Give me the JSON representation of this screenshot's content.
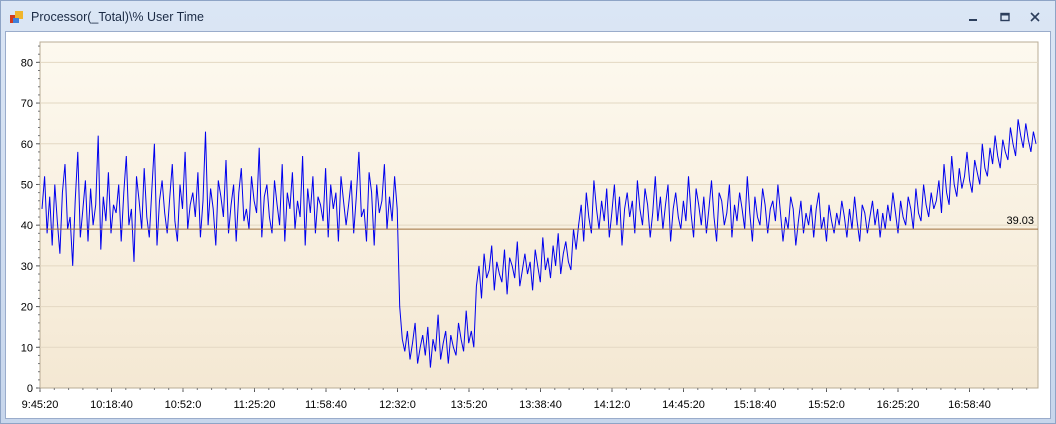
{
  "window": {
    "title": "Processor(_Total)\\% User Time",
    "colors": {
      "frame": "#c7d6ec",
      "plot_top": "#fdf9ef",
      "plot_bottom": "#f4e8d3",
      "series": "#0000ee",
      "avg_line": "#a0703c"
    }
  },
  "icons": [
    "app-icon",
    "minimize-icon",
    "restore-icon",
    "close-icon"
  ],
  "chart_data": {
    "type": "line",
    "title": "",
    "xlabel": "",
    "ylabel": "",
    "ylim": [
      0,
      85
    ],
    "yticks": [
      0,
      10,
      20,
      30,
      40,
      50,
      60,
      70,
      80
    ],
    "xticks": [
      "9:45:20",
      "10:18:40",
      "10:52:0",
      "11:25:20",
      "11:58:40",
      "12:32:0",
      "13:5:20",
      "13:38:40",
      "14:12:0",
      "14:45:20",
      "15:18:40",
      "15:52:0",
      "16:25:20",
      "16:58:40"
    ],
    "x_start": "9:45:20",
    "x_tick_interval": "0:33:20",
    "grid": true,
    "average": {
      "value": 39.03,
      "label": "39.03"
    },
    "series": [
      {
        "values": [
          44,
          52,
          38,
          47,
          35,
          50,
          41,
          33,
          48,
          55,
          39,
          42,
          30,
          46,
          58,
          37,
          44,
          51,
          36,
          49,
          40,
          45,
          62,
          34,
          47,
          41,
          53,
          38,
          45,
          43,
          50,
          36,
          48,
          57,
          40,
          44,
          31,
          52,
          46,
          39,
          54,
          42,
          37,
          49,
          60,
          35,
          46,
          51,
          43,
          38,
          47,
          55,
          41,
          36,
          50,
          44,
          58,
          39,
          45,
          48,
          42,
          53,
          37,
          46,
          63,
          40,
          49,
          44,
          35,
          51,
          47,
          42,
          56,
          38,
          45,
          50,
          36,
          48,
          54,
          41,
          44,
          39,
          52,
          46,
          43,
          59,
          37,
          47,
          50,
          42,
          38,
          51,
          45,
          40,
          55,
          36,
          48,
          44,
          53,
          39,
          46,
          42,
          57,
          35,
          49,
          43,
          52,
          38,
          47,
          45,
          41,
          54,
          37,
          50,
          44,
          48,
          36,
          52,
          46,
          40,
          45,
          51,
          38,
          47,
          58,
          42,
          44,
          36,
          53,
          48,
          35,
          50,
          43,
          46,
          55,
          39,
          47,
          41,
          52,
          44,
          20,
          12,
          9,
          14,
          7,
          11,
          16,
          6,
          10,
          13,
          8,
          15,
          5,
          12,
          9,
          18,
          7,
          11,
          14,
          6,
          13,
          10,
          8,
          16,
          12,
          9,
          19,
          11,
          14,
          10,
          25,
          30,
          22,
          33,
          27,
          29,
          35,
          24,
          31,
          28,
          26,
          34,
          23,
          32,
          30,
          27,
          36,
          25,
          29,
          33,
          28,
          31,
          24,
          34,
          30,
          26,
          37,
          29,
          32,
          27,
          35,
          30,
          38,
          28,
          33,
          36,
          31,
          29,
          39,
          34,
          40,
          45,
          36,
          48,
          42,
          38,
          51,
          44,
          39,
          46,
          41,
          49,
          37,
          43,
          50,
          40,
          47,
          35,
          44,
          48,
          42,
          46,
          38,
          51,
          44,
          40,
          49,
          45,
          37,
          43,
          52,
          41,
          47,
          39,
          45,
          50,
          36,
          44,
          48,
          42,
          39,
          46,
          41,
          52,
          43,
          37,
          49,
          45,
          40,
          47,
          38,
          44,
          51,
          42,
          36,
          48,
          46,
          40,
          43,
          50,
          37,
          45,
          41,
          48,
          44,
          39,
          52,
          43,
          36,
          47,
          42,
          40,
          49,
          45,
          38,
          44,
          46,
          41,
          50,
          43,
          36,
          42,
          39,
          47,
          44,
          35,
          41,
          46,
          38,
          43,
          40,
          45,
          37,
          44,
          48,
          39,
          42,
          36,
          45,
          41,
          38,
          43,
          40,
          46,
          42,
          37,
          44,
          39,
          47,
          41,
          36,
          45,
          43,
          38,
          42,
          46,
          40,
          44,
          37,
          43,
          39,
          45,
          41,
          48,
          43,
          38,
          46,
          42,
          40,
          47,
          44,
          39,
          49,
          43,
          41,
          50,
          45,
          42,
          48,
          44,
          46,
          51,
          43,
          55,
          48,
          45,
          57,
          50,
          47,
          54,
          49,
          52,
          58,
          51,
          48,
          56,
          53,
          50,
          60,
          54,
          52,
          59,
          55,
          62,
          57,
          54,
          61,
          58,
          56,
          64,
          60,
          57,
          66,
          62,
          59,
          65,
          61,
          58,
          63,
          60
        ]
      }
    ]
  }
}
